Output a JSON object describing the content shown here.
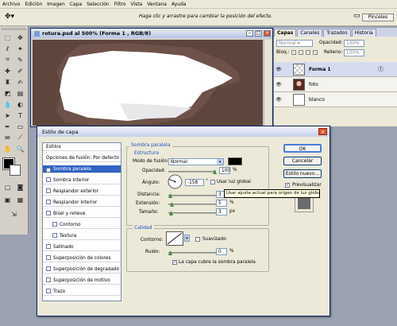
{
  "menubar": {
    "items": [
      "Archivo",
      "Edición",
      "Imagen",
      "Capa",
      "Selección",
      "Filtro",
      "Vista",
      "Ventana",
      "Ayuda"
    ]
  },
  "optionsbar": {
    "hint": "Haga clic y arrastre para cambiar la posición del efecto.",
    "brushes_label": "Pinceles"
  },
  "document": {
    "title": "rotura.psd al 500% (Forma 1 , RGB/8)"
  },
  "layers_panel": {
    "tabs": [
      "Capas",
      "Canales",
      "Trazados",
      "Historia"
    ],
    "opacity_label": "Opacidad:",
    "opacity_value": "100%",
    "lock_label": "Bloq.:",
    "fill_label": "Relleno:",
    "fill_value": "100%",
    "layers": [
      {
        "name": "Forma 1"
      },
      {
        "name": "foto"
      },
      {
        "name": "blanco"
      }
    ]
  },
  "dialog": {
    "title": "Estilo de capa",
    "styles": [
      {
        "label": "Estilos",
        "checkbox": false,
        "checked": false
      },
      {
        "label": "Opciones de fusión: Por defecto",
        "checkbox": false,
        "checked": false
      },
      {
        "label": "Sombra paralela",
        "checkbox": true,
        "checked": true
      },
      {
        "label": "Sombra interior",
        "checkbox": true,
        "checked": false
      },
      {
        "label": "Resplandor exterior",
        "checkbox": true,
        "checked": false
      },
      {
        "label": "Resplandor interior",
        "checkbox": true,
        "checked": false
      },
      {
        "label": "Bisel y relieve",
        "checkbox": true,
        "checked": false
      },
      {
        "label": "Contorno",
        "checkbox": true,
        "checked": false
      },
      {
        "label": "Textura",
        "checkbox": true,
        "checked": false
      },
      {
        "label": "Satinado",
        "checkbox": true,
        "checked": false
      },
      {
        "label": "Superposición de colores",
        "checkbox": true,
        "checked": false
      },
      {
        "label": "Superposición de degradado",
        "checkbox": true,
        "checked": false
      },
      {
        "label": "Superposición de motivo",
        "checkbox": true,
        "checked": false
      },
      {
        "label": "Trazo",
        "checkbox": true,
        "checked": false
      }
    ],
    "section_title": "Sombra paralela",
    "structure_title": "Estructura",
    "blend_mode_label": "Modo de fusión:",
    "blend_mode_value": "Normal",
    "opacity_label": "Opacidad:",
    "opacity_value": "100",
    "opacity_unit": "%",
    "angle_label": "Ángulo:",
    "angle_value": "-158",
    "angle_unit": "°",
    "global_light_label": "Usar luz global",
    "distance_label": "Distancia:",
    "distance_value": "3",
    "distance_unit": "px",
    "spread_label": "Extensión:",
    "spread_value": "5",
    "spread_unit": "%",
    "size_label": "Tamaño:",
    "size_value": "3",
    "size_unit": "px",
    "quality_title": "Calidad",
    "contour_label": "Contorno:",
    "antialias_label": "Suavizado",
    "noise_label": "Ruido:",
    "noise_value": "0",
    "noise_unit": "%",
    "knockout_label": "La capa cubre la sombra paralela",
    "ok_label": "OK",
    "cancel_label": "Cancelar",
    "new_style_label": "Estilo nuevo...",
    "preview_label": "Previsualizar",
    "tooltip": "Usar ajuste actual para origen de luz global",
    "shadow_color": "#000000"
  }
}
